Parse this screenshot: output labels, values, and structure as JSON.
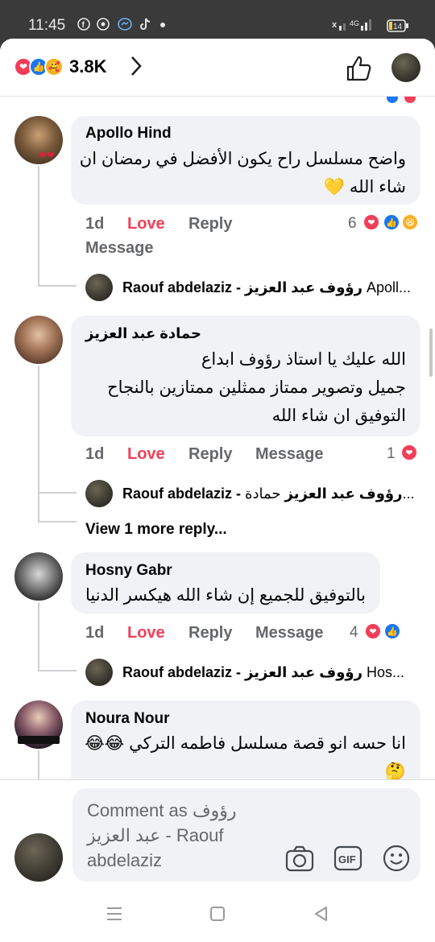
{
  "status_bar": {
    "time": "11:45",
    "left_icons": [
      "facebook-icon",
      "whatsapp-icon",
      "messenger-icon",
      "tiktok-icon",
      "dot-icon"
    ],
    "signal_text": "4G",
    "battery": "14"
  },
  "header": {
    "reaction_icons": [
      "love-reaction-icon",
      "like-reaction-icon",
      "care-reaction-icon"
    ],
    "reaction_count": "3.8K"
  },
  "comments": [
    {
      "author": "Apollo Hind",
      "text_lines": [
        "واضح مسلسل راح يكون الأفضل في رمضان ان",
        "شاء الله 💛"
      ],
      "time": "1d",
      "love_label": "Love",
      "reply_label": "Reply",
      "message_label": "Message",
      "reaction_count": "6",
      "reply_preview": {
        "author": "Raouf abdelaziz - رؤوف عبد العزيز",
        "snippet": "Apoll..."
      }
    },
    {
      "author": "حمادة عبد العزيز",
      "text_lines": [
        "الله عليك يا استاذ رؤوف ابداع",
        "جميل وتصوير ممتاز ممثلين ممتازين بالنجاح",
        "التوفيق ان شاء الله"
      ],
      "time": "1d",
      "love_label": "Love",
      "reply_label": "Reply",
      "message_label": "Message",
      "reaction_count": "1",
      "reply_preview": {
        "author": "Raouf abdelaziz - رؤوف عبد العزيز",
        "snippet": "حمادة..."
      },
      "view_more": "View 1 more reply..."
    },
    {
      "author": "Hosny Gabr",
      "text_lines": [
        "بالتوفيق للجميع إن شاء الله هيكسر الدنيا"
      ],
      "time": "1d",
      "love_label": "Love",
      "reply_label": "Reply",
      "message_label": "Message",
      "reaction_count": "4",
      "reply_preview": {
        "author": "Raouf abdelaziz - رؤوف عبد العزيز",
        "snippet": "Hos..."
      }
    },
    {
      "author": "Noura Nour",
      "text_lines": [
        "انا حسه انو قصة مسلسل فاطمه التركي 😂😂",
        "🤔"
      ]
    }
  ],
  "composer": {
    "placeholder_line1": "Comment as رؤوف",
    "placeholder_line2": "عبد العزيز - Raouf",
    "placeholder_line3": "abdelaziz",
    "gif_label": "GIF"
  },
  "colors": {
    "love": "#f33e58",
    "like": "#1877f2",
    "bubble": "#f0f2f5",
    "meta": "#65676b"
  }
}
